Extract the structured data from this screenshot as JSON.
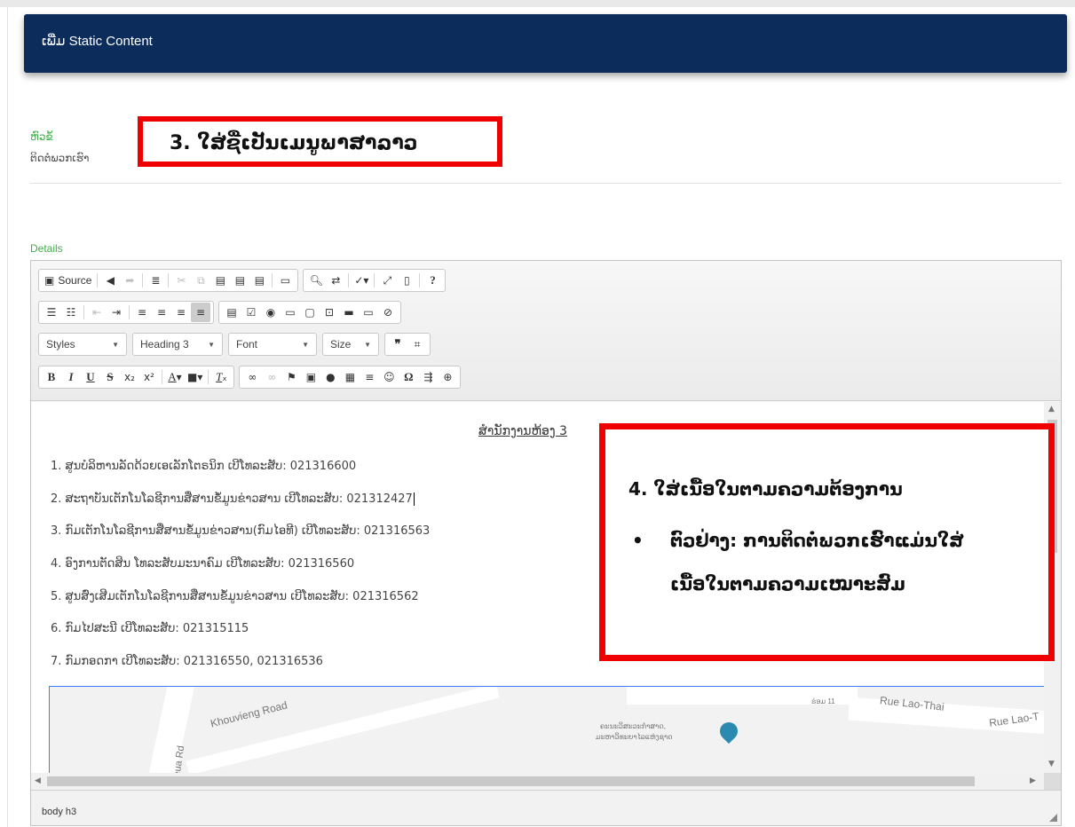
{
  "header": {
    "title": "ເພີ່ມ Static Content"
  },
  "title_field": {
    "label": "ຫົວຂໍ້",
    "value": "ຕິດຕໍ່ພວກເຮົາ"
  },
  "callout_3": {
    "text": "3.  ໃສ່ຊື່ເປັນເມນູພາສາລາວ"
  },
  "details_field": {
    "label": "Details"
  },
  "toolbar": {
    "source_label": "Source",
    "combos": {
      "styles": "Styles",
      "format": "Heading 3",
      "font": "Font",
      "size": "Size"
    }
  },
  "document": {
    "heading": "ສຳນັກງານຫ້ອງ 3",
    "items": [
      "1. ສູນບໍລິຫານລັດດ້ວຍເອເລັກໂຕຣນິກ ເບີໂທລະສັບ: 021316600",
      "2. ສະຖາບັນເຕັກໂນໂລຊີການສື່ສານຂໍ້ມູນຂ່າວສານ ເບີໂທລະສັບ: 021312427",
      "3. ກົມເຕັກໂນໂລຊີການສື່ສານຂໍ້ມູນຂ່າວສານ(ກົມໄອທີ) ເບີໂທລະສັບ: 021316563",
      "4. ອົງການຕັດສິນ ໂທລະສັບມະນາຄົມ ເບີໂທລະສັບ: 021316560",
      "5. ສູນສົ່ງເສີມເຕັກໂນໂລຊີການສື່ສານຂໍ້ມູນຂ່າວສານ ເບີໂທລະສັບ: 021316562",
      "6. ກົມໄປສະນີ ເບີໂທລະສັບ: 021315115",
      "7. ກົມກອດກາ ເບີໂທລະສັບ: 021316550, 021316536"
    ]
  },
  "map": {
    "labels": {
      "khouvieng": "Khouvieng Road",
      "rd": "eua Rd",
      "ban": "ຮ່ອມ 11",
      "lao_thai_1": "Rue Lao-Thai",
      "lao_thai_2": "Rue Lao-T",
      "poi_line1": "ຄະນະວິສະວະກຳສາດ,",
      "poi_line2": "ມະຫາວິທະຍາໄລແຫ່ງຊາດ"
    }
  },
  "statusbar": {
    "path": "body  h3"
  },
  "callout_4": {
    "line1": "4.  ໃສ່ເນື້ອໃນຕາມຄວາມຕ້ອງການ",
    "bullet": "•",
    "line2": "ຕົວຢ່າງ: ການຕິດຕໍ່ພວກເຮົາແມ່ນໃສ່",
    "line3": "ເນື້ອໃນຕາມຄວາມເໝາະສົມ"
  },
  "colors": {
    "header_bg": "#0c2d5b",
    "label_green": "#3fae49",
    "callout_red": "#f00000"
  }
}
